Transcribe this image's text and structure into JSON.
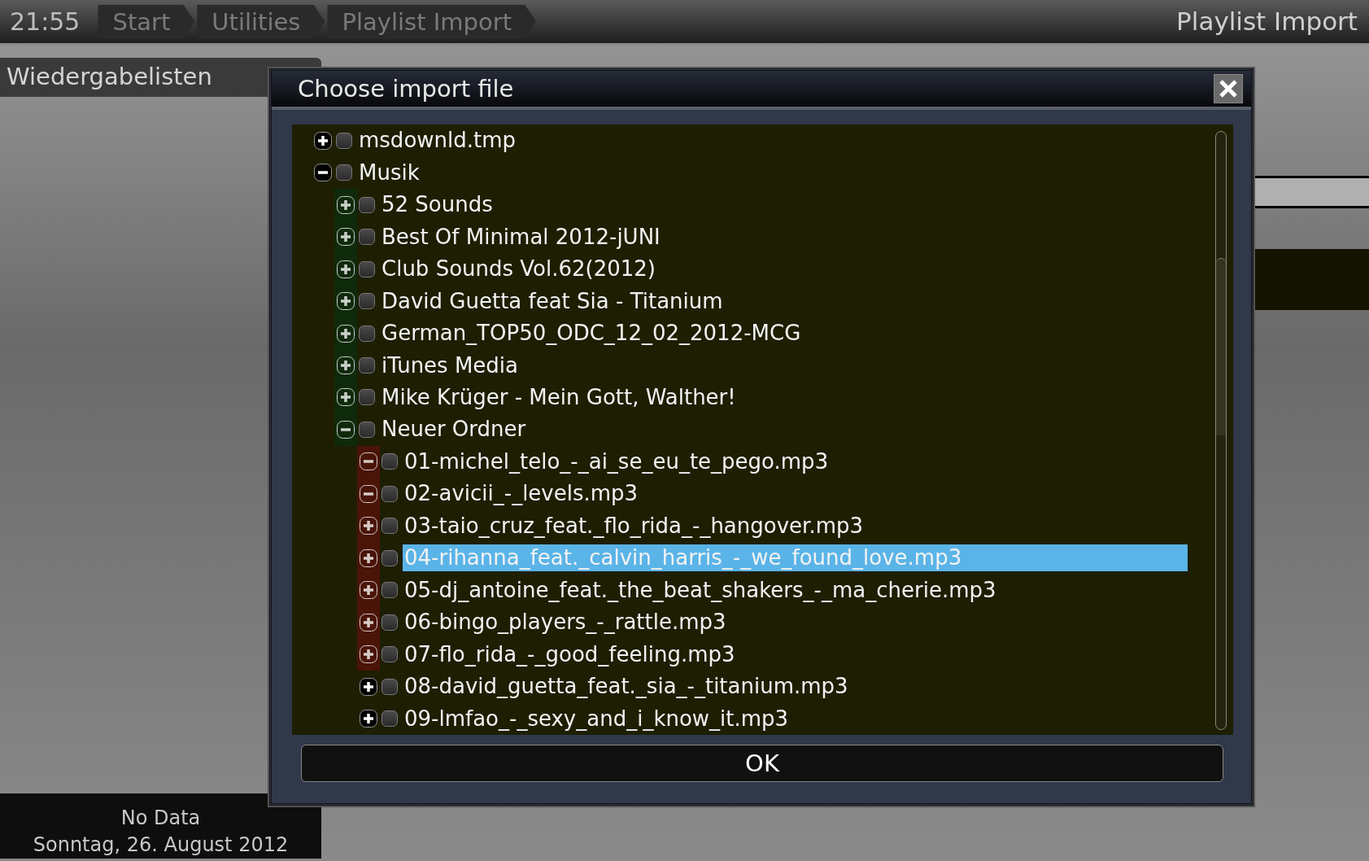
{
  "top_bar": {
    "clock": "21:55",
    "breadcrumbs": [
      "Start",
      "Utilities",
      "Playlist Import"
    ],
    "title": "Playlist Import"
  },
  "side_panel": {
    "title": "Wiedergabelisten"
  },
  "status": {
    "lines": [
      "No Data",
      "Sonntag, 26. August 2012"
    ]
  },
  "dialog": {
    "title": "Choose import file",
    "ok_button": "OK",
    "tree": [
      {
        "label": "msdownld.tmp",
        "expanded": false,
        "checked": false,
        "selected": false
      },
      {
        "label": "Musik",
        "expanded": true,
        "checked": false,
        "selected": false,
        "children": [
          {
            "label": "52 Sounds",
            "expanded": false,
            "checked": false,
            "selected": false,
            "color": "#0f2a0b"
          },
          {
            "label": "Best Of Minimal 2012-jUNI",
            "expanded": false,
            "checked": false,
            "selected": false,
            "color": "#0f2a0b"
          },
          {
            "label": "Club Sounds Vol.62(2012)",
            "expanded": false,
            "checked": false,
            "selected": false,
            "color": "#0f2a0b"
          },
          {
            "label": "David Guetta feat Sia - Titanium",
            "expanded": false,
            "checked": false,
            "selected": false,
            "color": "#0f2a0b"
          },
          {
            "label": "German_TOP50_ODC_12_02_2012-MCG",
            "expanded": false,
            "checked": false,
            "selected": false,
            "color": "#0f2a0b"
          },
          {
            "label": "iTunes Media",
            "expanded": false,
            "checked": false,
            "selected": false,
            "color": "#0f2a0b"
          },
          {
            "label": "Mike Krüger - Mein Gott, Walther!",
            "expanded": false,
            "checked": false,
            "selected": false,
            "color": "#0f2a0b"
          },
          {
            "label": "Neuer Ordner",
            "expanded": true,
            "checked": false,
            "selected": false,
            "color": "#0f2a0b",
            "children": [
              {
                "label": "01-michel_telo_-_ai_se_eu_te_pego.mp3",
                "expanded": true,
                "checked": false,
                "selected": false,
                "color": "#4a1406"
              },
              {
                "label": "02-avicii_-_levels.mp3",
                "expanded": true,
                "checked": false,
                "selected": false,
                "color": "#4a1406"
              },
              {
                "label": "03-taio_cruz_feat._flo_rida_-_hangover.mp3",
                "expanded": false,
                "checked": false,
                "selected": false,
                "color": "#4a1406"
              },
              {
                "label": "04-rihanna_feat._calvin_harris_-_we_found_love.mp3",
                "expanded": false,
                "checked": false,
                "selected": true,
                "color": "#4a1406"
              },
              {
                "label": "05-dj_antoine_feat._the_beat_shakers_-_ma_cherie.mp3",
                "expanded": false,
                "checked": false,
                "selected": false,
                "color": "#4a1406"
              },
              {
                "label": "06-bingo_players_-_rattle.mp3",
                "expanded": false,
                "checked": false,
                "selected": false,
                "color": "#4a1406"
              },
              {
                "label": "07-flo_rida_-_good_feeling.mp3",
                "expanded": false,
                "checked": false,
                "selected": false,
                "color": "#4a1406"
              },
              {
                "label": "08-david_guetta_feat._sia_-_titanium.mp3",
                "expanded": false,
                "checked": false,
                "selected": false
              },
              {
                "label": "09-lmfao_-_sexy_and_i_know_it.mp3",
                "expanded": false,
                "checked": false,
                "selected": false
              }
            ]
          }
        ]
      }
    ]
  }
}
